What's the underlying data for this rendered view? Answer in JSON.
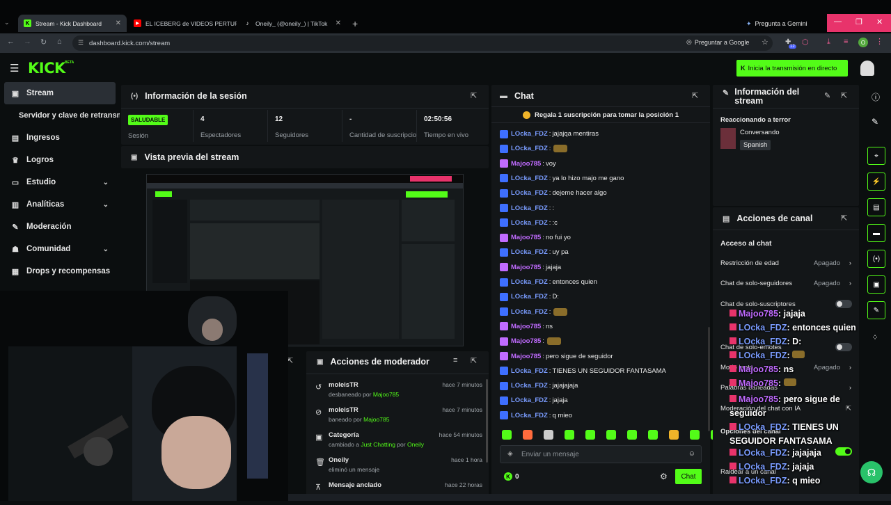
{
  "browser": {
    "tabs": [
      {
        "label": "Stream - Kick Dashboard",
        "active": true
      },
      {
        "label": "EL ICEBERG de VIDEOS PERTUR",
        "active": false
      },
      {
        "label": "Oneily_ (@oneily_) | TikTok",
        "active": false
      }
    ],
    "gemini": "Pregunta a Gemini",
    "url": "dashboard.kick.com/stream",
    "google_btn": "Preguntar a Google",
    "ext_badge": "12",
    "profile_initial": "O"
  },
  "header": {
    "logo": "KICK",
    "beta": "BETA",
    "go_live": "Inicia la transmisión en directo"
  },
  "sidebar": {
    "items": [
      {
        "label": "Stream",
        "icon": "stream-icon"
      },
      {
        "label": "Servidor y clave de retransmisión"
      },
      {
        "label": "Ingresos",
        "icon": "chart-icon"
      },
      {
        "label": "Logros",
        "icon": "trophy-icon"
      },
      {
        "label": "Estudio",
        "icon": "studio-icon"
      },
      {
        "label": "Analíticas",
        "icon": "analytics-icon"
      },
      {
        "label": "Moderación",
        "icon": "wrench-icon"
      },
      {
        "label": "Comunidad",
        "icon": "community-icon"
      },
      {
        "label": "Drops y recompensas",
        "icon": "gift-icon"
      }
    ]
  },
  "session": {
    "title": "Información de la sesión",
    "status": "SALUDABLE",
    "status_label": "Sesión",
    "stats": [
      {
        "value": "4",
        "label": "Espectadores"
      },
      {
        "value": "12",
        "label": "Seguidores"
      },
      {
        "value": "-",
        "label": "Cantidad de suscripciones"
      },
      {
        "value": "02:50:56",
        "label": "Tiempo en vivo"
      }
    ]
  },
  "preview": {
    "title": "Vista previa del stream"
  },
  "mod_actions": {
    "title": "Acciones de moderador",
    "rows": [
      {
        "user": "moleisTR",
        "time": "hace 7 minutos",
        "pre": "desbaneado por ",
        "link": "Majoo785",
        "icon": "undo-icon"
      },
      {
        "user": "moleisTR",
        "time": "hace 7 minutos",
        "pre": "baneado por ",
        "link": "Majoo785",
        "icon": "ban-icon"
      },
      {
        "user": "Categoría",
        "time": "hace 54 minutos",
        "pre": "cambiado a ",
        "link": "Just Chatting",
        "mid": " por ",
        "link2": "Oneily",
        "icon": "category-icon"
      },
      {
        "user": "Oneily",
        "time": "hace 1 hora",
        "pre": "eliminó un mensaje",
        "icon": "trash-icon"
      },
      {
        "user": "Mensaje anclado",
        "time": "hace 22 horas",
        "pre": "",
        "icon": "pin-icon"
      }
    ]
  },
  "chat": {
    "title": "Chat",
    "promo": "Regala 1 suscripción para tomar la posición 1",
    "messages": [
      {
        "user": "LOcka_FDZ",
        "text": "jajajqa mentiras"
      },
      {
        "user": "LOcka_FDZ",
        "text": "[emote]"
      },
      {
        "user": "Majoo785",
        "text": "voy"
      },
      {
        "user": "LOcka_FDZ",
        "text": "ya lo hizo majo me gano"
      },
      {
        "user": "LOcka_FDZ",
        "text": "dejeme hacer algo"
      },
      {
        "user": "LOcka_FDZ",
        "text": ":"
      },
      {
        "user": "LOcka_FDZ",
        "text": ":c"
      },
      {
        "user": "Majoo785",
        "text": "no fui yo"
      },
      {
        "user": "LOcka_FDZ",
        "text": "uy pa"
      },
      {
        "user": "Majoo785",
        "text": "jajaja"
      },
      {
        "user": "LOcka_FDZ",
        "text": "entonces quien"
      },
      {
        "user": "LOcka_FDZ",
        "text": "D:"
      },
      {
        "user": "LOcka_FDZ",
        "text": "[emote]"
      },
      {
        "user": "Majoo785",
        "text": "ns"
      },
      {
        "user": "Majoo785",
        "text": "[emote]"
      },
      {
        "user": "Majoo785",
        "text": "pero sigue de seguidor"
      },
      {
        "user": "LOcka_FDZ",
        "text": "TIENES UN SEGUIDOR FANTASAMA"
      },
      {
        "user": "LOcka_FDZ",
        "text": "jajajajaja"
      },
      {
        "user": "LOcka_FDZ",
        "text": "jajaja"
      },
      {
        "user": "LOcka_FDZ",
        "text": "q mieo"
      }
    ],
    "placeholder": "Enviar un mensaje",
    "points": "0",
    "send": "Chat"
  },
  "stream_info": {
    "title": "Información del stream",
    "stream_title": "Reaccionando a terror",
    "category": "Conversando",
    "language": "Spanish"
  },
  "channel_actions": {
    "title": "Acciones de canal",
    "section": "Acceso al chat",
    "rows": [
      {
        "label": "Restricción de edad",
        "value": "Apagado"
      },
      {
        "label": "Chat de solo-seguidores",
        "value": "Apagado"
      },
      {
        "label": "Chat de solo-suscriptores"
      },
      {
        "label": "Chat de solo-emotes"
      },
      {
        "label": "Modo lento",
        "value": "Apagado"
      },
      {
        "label": "Palabras baneadas"
      },
      {
        "label": "Moderación del chat con IA"
      },
      {
        "label": "Opciones del canal"
      },
      {
        "label": "Raidear a un canal"
      }
    ]
  },
  "overlay_chat": [
    {
      "user": "Majoo785",
      "text": "jajaja"
    },
    {
      "user": "LOcka_FDZ",
      "text": "entonces quien"
    },
    {
      "user": "LOcka_FDZ",
      "text": "D:"
    },
    {
      "user": "LOcka_FDZ",
      "text": "[emote]"
    },
    {
      "user": "Majoo785",
      "text": "ns"
    },
    {
      "user": "Majoo785",
      "text": "[emote]"
    },
    {
      "user": "Majoo785",
      "text": "pero sigue de seguidor"
    },
    {
      "user": "LOcka_FDZ",
      "text": "TIENES UN SEGUIDOR FANTASAMA"
    },
    {
      "user": "LOcka_FDZ",
      "text": "jajajaja"
    },
    {
      "user": "LOcka_FDZ",
      "text": "jajaja"
    },
    {
      "user": "LOcka_FDZ",
      "text": "q mieo"
    }
  ],
  "colors": {
    "kick_green": "#53fc18",
    "user_blue": "#7a9cff",
    "user_purple": "#c06bff"
  }
}
